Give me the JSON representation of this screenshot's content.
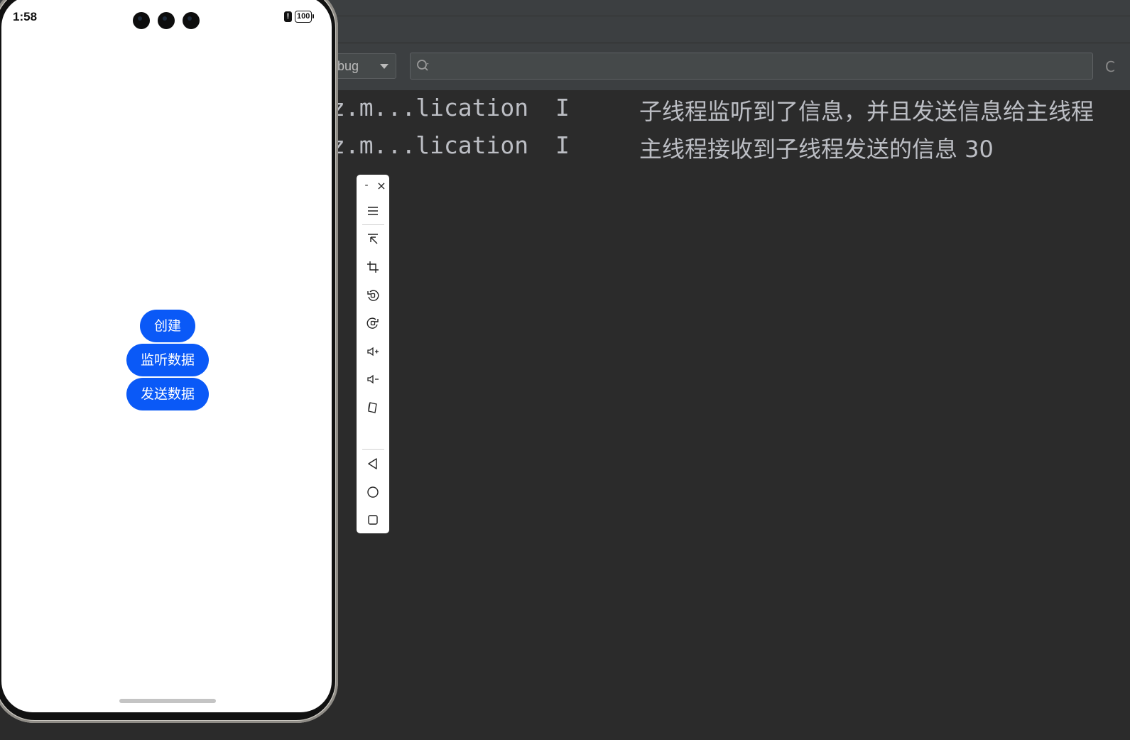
{
  "status_bar": {
    "time": "1:58",
    "battery": "100",
    "alert": "!"
  },
  "app": {
    "buttons": {
      "create": "创建",
      "listen": "监听数据",
      "send": "发送数据"
    }
  },
  "logcat": {
    "level_select": "bug",
    "search_placeholder": "",
    "rows": [
      {
        "tag": "z.m...lication",
        "level": "I",
        "message": "子线程监听到了信息，并且发送信息给主线程"
      },
      {
        "tag": "z.m...lication",
        "level": "I",
        "message": "主线程接收到子线程发送的信息 30"
      }
    ]
  },
  "emulator_toolbar": {
    "minimize": "-",
    "close": "×",
    "icons": [
      "menu-icon",
      "pointer-icon",
      "crop-icon",
      "rotate-left-icon",
      "rotate-right-icon",
      "volume-up-icon",
      "volume-down-icon",
      "fold-icon",
      "back-icon",
      "home-icon",
      "overview-icon"
    ]
  },
  "colors": {
    "ide_bg": "#2b2b2b",
    "button_blue": "#0a59f7",
    "log_text": "#bcbec4"
  }
}
